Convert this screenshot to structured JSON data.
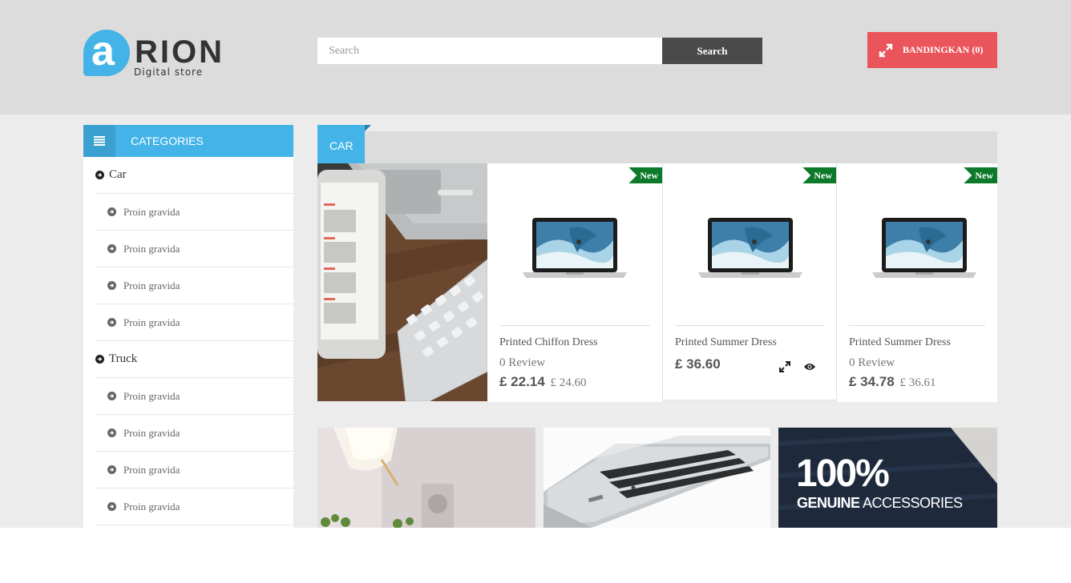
{
  "header": {
    "logo_letter": "a",
    "logo_name": "RION",
    "logo_tagline": "Digital store",
    "search_placeholder": "Search",
    "search_button": "Search",
    "compare_label": "BANDINGKAN (0)"
  },
  "sidebar": {
    "title": "CATEGORIES",
    "items": [
      {
        "label": "Car",
        "level": "top"
      },
      {
        "label": "Proin gravida",
        "level": "sub"
      },
      {
        "label": "Proin gravida",
        "level": "sub"
      },
      {
        "label": "Proin gravida",
        "level": "sub"
      },
      {
        "label": "Proin gravida",
        "level": "sub"
      },
      {
        "label": "Truck",
        "level": "top"
      },
      {
        "label": "Proin gravida",
        "level": "sub"
      },
      {
        "label": "Proin gravida",
        "level": "sub"
      },
      {
        "label": "Proin gravida",
        "level": "sub"
      },
      {
        "label": "Proin gravida",
        "level": "sub"
      }
    ]
  },
  "section": {
    "title": "CAR"
  },
  "products": [
    {
      "badge": "New",
      "name": "Printed Chiffon Dress",
      "review": "0 Review",
      "price": "£ 22.14",
      "old_price": "£ 24.60"
    },
    {
      "badge": "New",
      "name": "Printed Summer Dress",
      "review": "",
      "price": "£ 36.60",
      "old_price": ""
    },
    {
      "badge": "New",
      "name": "Printed Summer Dress",
      "review": "0 Review",
      "price": "£ 34.78",
      "old_price": "£ 36.61"
    }
  ],
  "banners": {
    "accessories_big": "100%",
    "accessories_bold": "GENUINE",
    "accessories_rest": " ACCESSORIES"
  },
  "colors": {
    "accent": "#44b4e8",
    "compare": "#e9555a",
    "badge": "#0c7a2a"
  }
}
